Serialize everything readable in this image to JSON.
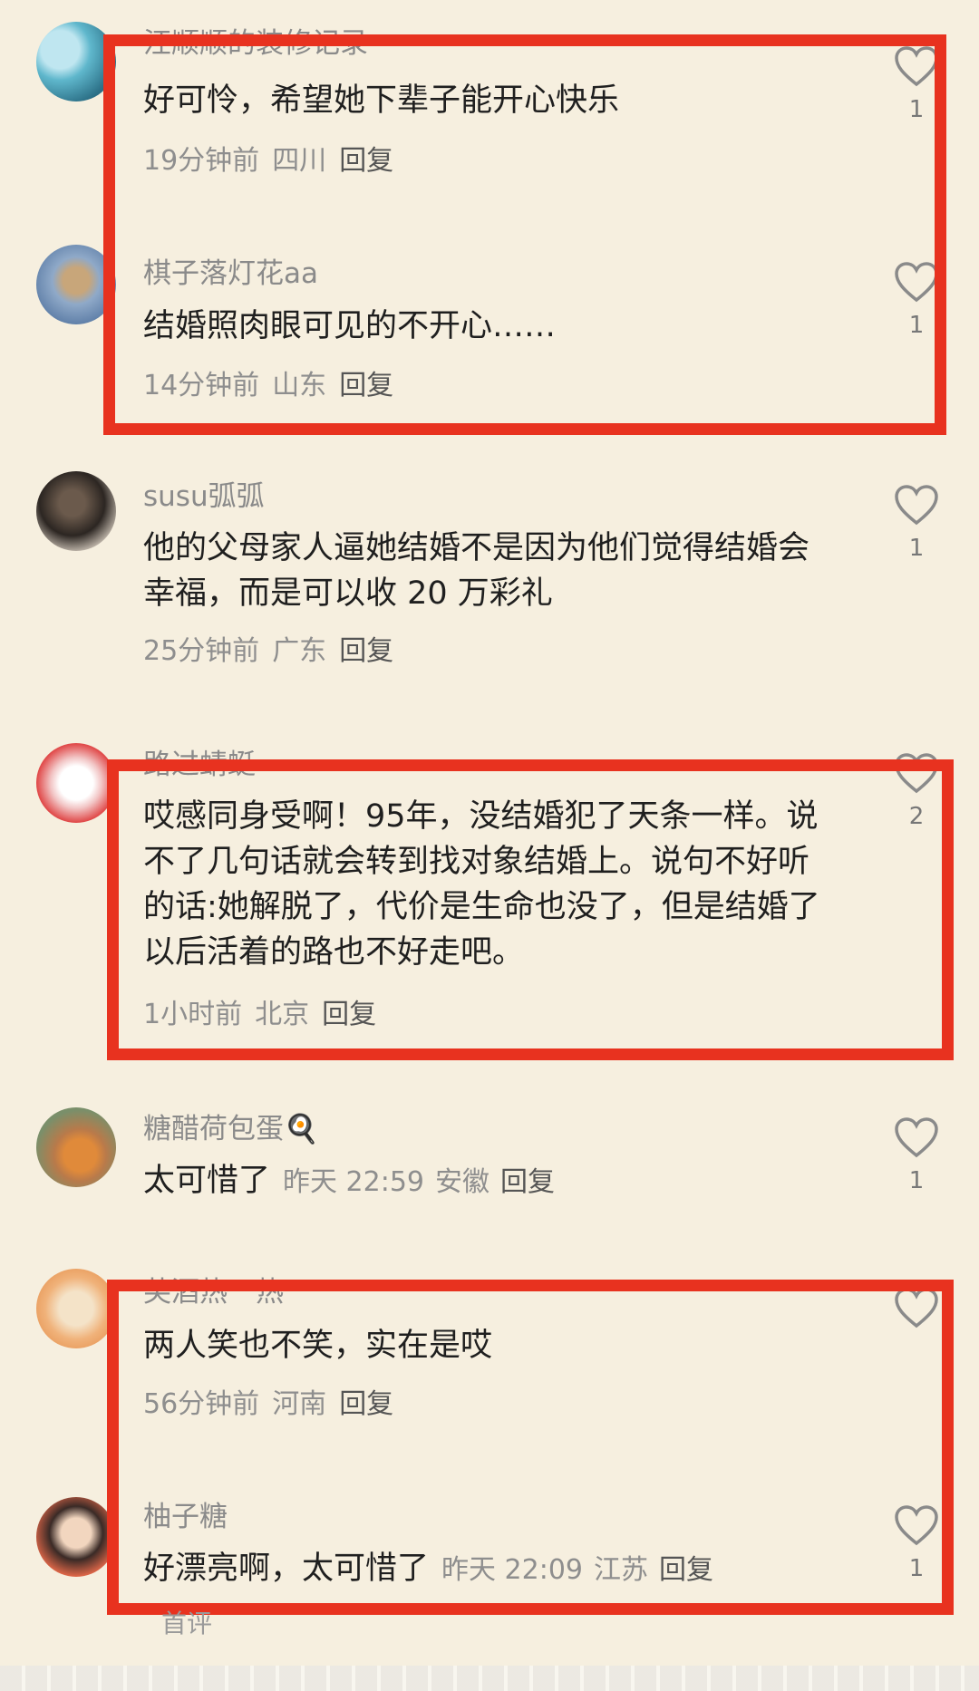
{
  "comments": [
    {
      "username": "汪顺顺的装修记录",
      "text": "好可怜，希望她下辈子能开心快乐",
      "time": "19分钟前",
      "location": "四川",
      "reply": "回复",
      "likes": "1"
    },
    {
      "username": "棋子落灯花aa",
      "text": "结婚照肉眼可见的不开心……",
      "time": "14分钟前",
      "location": "山东",
      "reply": "回复",
      "likes": "1"
    },
    {
      "username": "susu弧弧",
      "text": "他的父母家人逼她结婚不是因为他们觉得结婚会幸福，而是可以收 20 万彩礼",
      "time": "25分钟前",
      "location": "广东",
      "reply": "回复",
      "likes": "1"
    },
    {
      "username": "路过蜻蜓",
      "text": "哎感同身受啊！95年，没结婚犯了天条一样。说不了几句话就会转到找对象结婚上。说句不好听的话:她解脱了，代价是生命也没了，但是结婚了以后活着的路也不好走吧。",
      "time": "1小时前",
      "location": "北京",
      "reply": "回复",
      "likes": "2"
    },
    {
      "username": "糖醋荷包蛋🍳",
      "text": "太可惜了",
      "time": "昨天 22:59",
      "location": "安徽",
      "reply": "回复",
      "likes": "1"
    },
    {
      "username": "芙酒热一热",
      "text": "两人笑也不笑，实在是哎",
      "time": "56分钟前",
      "location": "河南",
      "reply": "回复",
      "likes": ""
    },
    {
      "username": "柚子糖",
      "text": "好漂亮啊，太可惜了",
      "time": "昨天 22:09",
      "location": "江苏",
      "reply": "回复",
      "likes": "1"
    }
  ],
  "footer": {
    "label": "首评"
  },
  "colors": {
    "highlight_border": "#e8321f",
    "background": "#f6efdf"
  }
}
